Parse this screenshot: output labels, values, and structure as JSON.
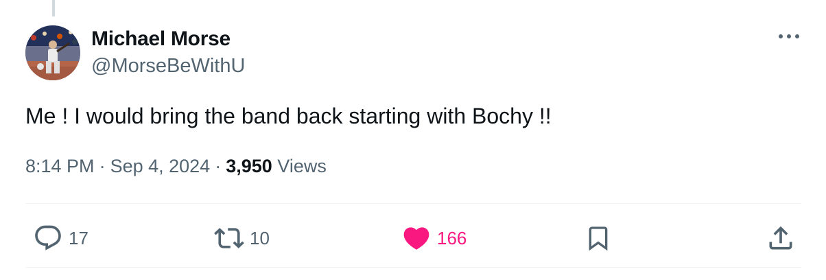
{
  "author": {
    "display_name": "Michael Morse",
    "handle": "@MorseBeWithU"
  },
  "tweet": {
    "text": "Me ! I would bring the band back starting with Bochy !!",
    "time": "8:14 PM",
    "date": "Sep 4, 2024",
    "views_count": "3,950",
    "views_label": "Views",
    "separator": "·"
  },
  "actions": {
    "reply_count": "17",
    "retweet_count": "10",
    "like_count": "166"
  },
  "icons": {
    "more": "more-horizontal-icon",
    "reply": "reply-icon",
    "retweet": "retweet-icon",
    "like": "heart-filled-icon",
    "bookmark": "bookmark-icon",
    "share": "share-icon"
  },
  "colors": {
    "like_active": "#f91880",
    "secondary_text": "#536471",
    "primary_text": "#0f1419"
  }
}
